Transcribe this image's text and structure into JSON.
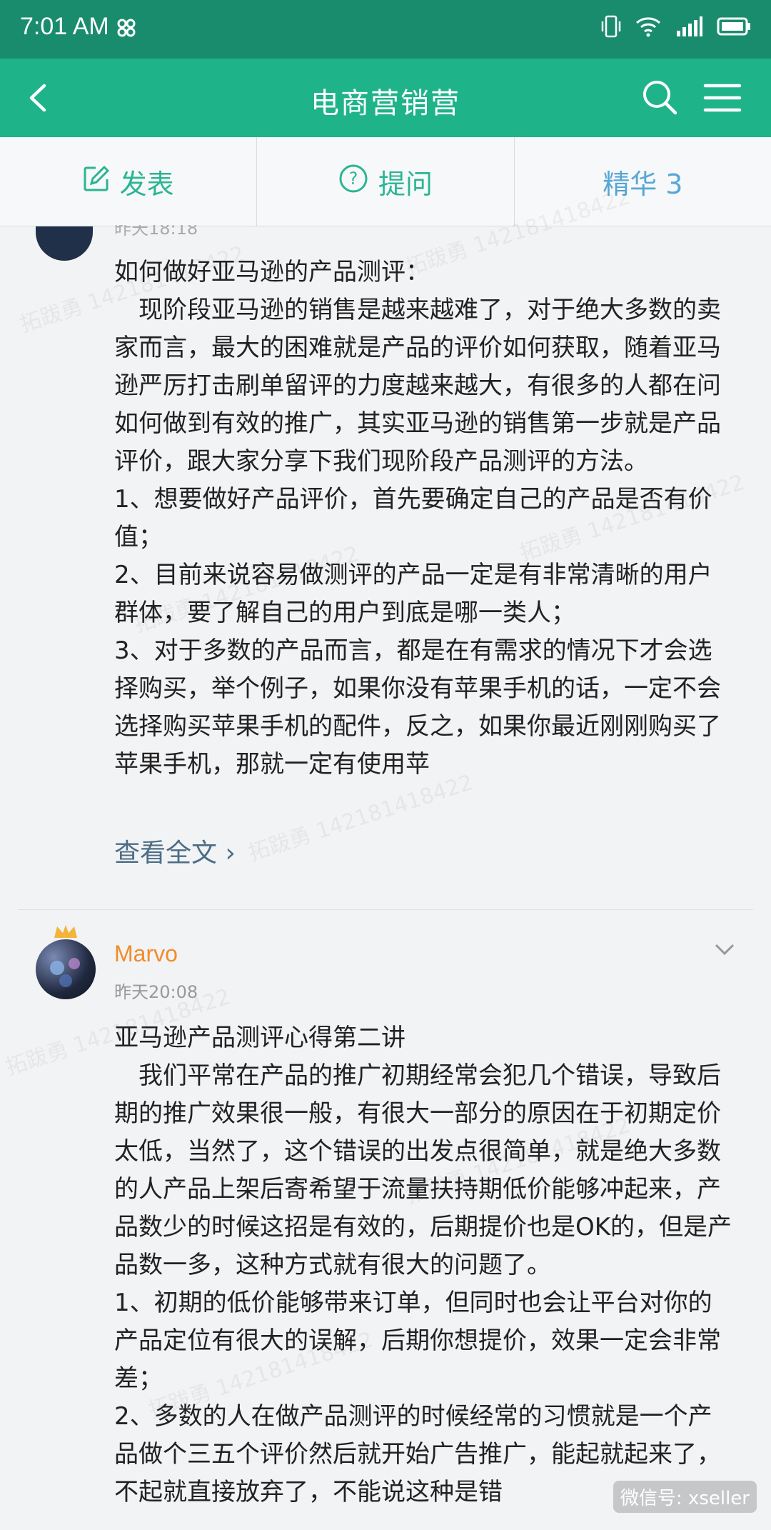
{
  "status": {
    "time": "7:01 AM"
  },
  "nav": {
    "title": "电商营销营"
  },
  "tabs": {
    "post": "发表",
    "ask": "提问",
    "featured": "精华 3"
  },
  "post1": {
    "time_partial": "昨天18:18",
    "lines": [
      "如何做好亚马逊的产品测评：",
      "现阶段亚马逊的销售是越来越难了，对于绝大多数的卖家而言，最大的困难就是产品的评价如何获取，随着亚马逊严厉打击刷单留评的力度越来越大，有很多的人都在问如何做到有效的推广，其实亚马逊的销售第一步就是产品评价，跟大家分享下我们现阶段产品测评的方法。",
      "1、想要做好产品评价，首先要确定自己的产品是否有价值；",
      "2、目前来说容易做测评的产品一定是有非常清晰的用户群体，要了解自己的用户到底是哪一类人；",
      "3、对于多数的产品而言，都是在有需求的情况下才会选择购买，举个例子，如果你没有苹果手机的话，一定不会选择购买苹果手机的配件，反之，如果你最近刚刚购买了苹果手机，那就一定有使用苹"
    ],
    "read_more": "查看全文 ›"
  },
  "post2": {
    "username": "Marvo",
    "time": "昨天20:08",
    "lines": [
      "亚马逊产品测评心得第二讲",
      "我们平常在产品的推广初期经常会犯几个错误，导致后期的推广效果很一般，有很大一部分的原因在于初期定价太低，当然了，这个错误的出发点很简单，就是绝大多数的人产品上架后寄希望于流量扶持期低价能够冲起来，产品数少的时候这招是有效的，后期提价也是OK的，但是产品数一多，这种方式就有很大的问题了。",
      "1、初期的低价能够带来订单，但同时也会让平台对你的产品定位有很大的误解，后期你想提价，效果一定会非常差；",
      "2、多数的人在做产品测评的时候经常的习惯就是一个产品做个三五个评价然后就开始广告推广，能起就起来了，不起就直接放弃了，不能说这种是错"
    ]
  },
  "watermark": "拓跋勇 142181418422",
  "wechat": "微信号: xseller"
}
